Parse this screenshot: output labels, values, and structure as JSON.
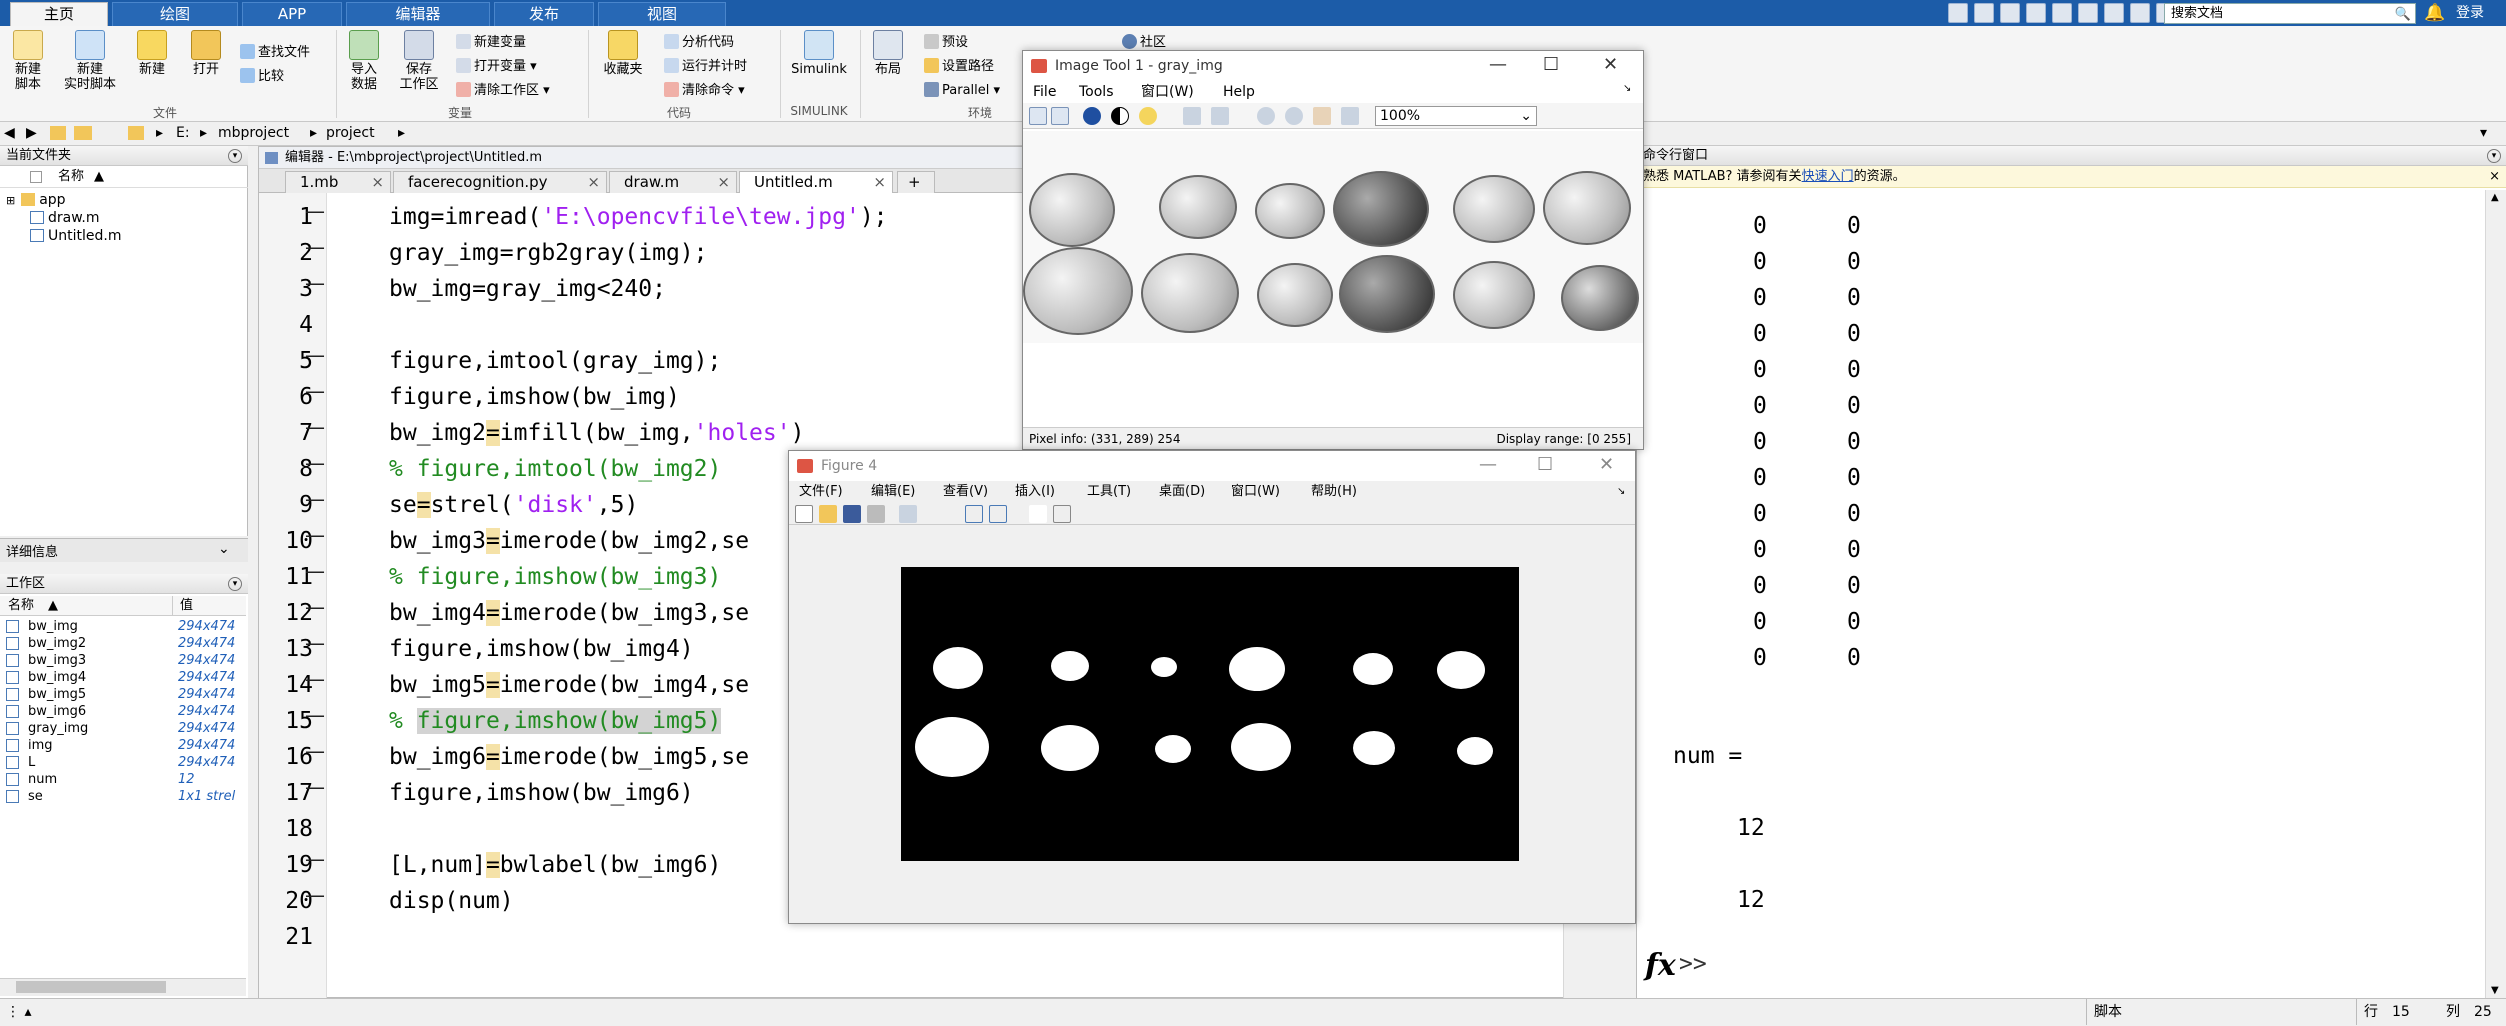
{
  "top_tabs": [
    "主页",
    "绘图",
    "APP",
    "编辑器",
    "发布",
    "视图"
  ],
  "search": {
    "placeholder": "搜索文档"
  },
  "login": "登录",
  "ribbon": {
    "file": {
      "new_script": "新建\n脚本",
      "new_live": "新建\n实时脚本",
      "new": "新建",
      "open": "打开",
      "find_files": "查找文件",
      "compare": "比较",
      "group": "文件"
    },
    "variable": {
      "import": "导入\n数据",
      "save_ws": "保存\n工作区",
      "new_var": "新建变量",
      "open_var": "打开变量",
      "clear_ws": "清除工作区",
      "group": "变量"
    },
    "code": {
      "favorites": "收藏夹",
      "analyze": "分析代码",
      "run_time": "运行并计时",
      "clear_cmd": "清除命令",
      "group": "代码"
    },
    "simulink": {
      "label": "Simulink",
      "group": "SIMULINK"
    },
    "env": {
      "layout": "布局",
      "prefs": "预设",
      "set_path": "设置路径",
      "parallel": "Parallel",
      "group": "环境"
    },
    "community": "社区"
  },
  "address": {
    "drive": "E:",
    "seg1": "mbproject",
    "seg2": "project"
  },
  "current_folder": {
    "title": "当前文件夹",
    "col": "名称",
    "items": [
      "app",
      "draw.m",
      "Untitled.m"
    ]
  },
  "details": {
    "title": "详细信息"
  },
  "workspace": {
    "title": "工作区",
    "col_name": "名称",
    "col_value": "值",
    "rows": [
      {
        "name": "bw_img",
        "value": "294x474"
      },
      {
        "name": "bw_img2",
        "value": "294x474"
      },
      {
        "name": "bw_img3",
        "value": "294x474"
      },
      {
        "name": "bw_img4",
        "value": "294x474"
      },
      {
        "name": "bw_img5",
        "value": "294x474"
      },
      {
        "name": "bw_img6",
        "value": "294x474"
      },
      {
        "name": "gray_img",
        "value": "294x474"
      },
      {
        "name": "img",
        "value": "294x474"
      },
      {
        "name": "L",
        "value": "294x474"
      },
      {
        "name": "num",
        "value": "12"
      },
      {
        "name": "se",
        "value": "1x1 strel"
      }
    ]
  },
  "editor": {
    "title": "编辑器 - E:\\mbproject\\project\\Untitled.m",
    "tabs": [
      "1.mb",
      "facerecognition.py",
      "draw.m",
      "Untitled.m"
    ],
    "lines": [
      "img=imread('E:\\opencvfile\\tew.jpg');",
      "gray_img=rgb2gray(img);",
      "bw_img=gray_img<240;",
      "",
      "figure,imtool(gray_img);",
      "figure,imshow(bw_img)",
      "bw_img2=imfill(bw_img,'holes')",
      "% figure,imtool(bw_img2)",
      "se=strel('disk',5)",
      "bw_img3=imerode(bw_img2,se",
      "% figure,imshow(bw_img3)",
      "bw_img4=imerode(bw_img3,se",
      "figure,imshow(bw_img4)",
      "bw_img5=imerode(bw_img4,se",
      "% figure,imshow(bw_img5)",
      "bw_img6=imerode(bw_img5,se",
      "figure,imshow(bw_img6)",
      "",
      "[L,num]=bwlabel(bw_img6)",
      "disp(num)",
      ""
    ]
  },
  "imtool": {
    "title": "Image Tool 1 - gray_img",
    "menu": [
      "File",
      "Tools",
      "窗口(W)",
      "Help"
    ],
    "zoom": "100%",
    "pixel_info": "Pixel info: (331, 289)  254",
    "display_range": "Display range: [0 255]"
  },
  "fig4": {
    "title": "Figure 4",
    "menu": [
      "文件(F)",
      "编辑(E)",
      "查看(V)",
      "插入(I)",
      "工具(T)",
      "桌面(D)",
      "窗口(W)",
      "帮助(H)"
    ]
  },
  "cmd": {
    "title": "命令行窗口",
    "banner_pre": "熟悉 MATLAB? 请参阅有关",
    "banner_link": "快速入门",
    "banner_post": "的资源。",
    "zero_cell": "0",
    "num_label": "num =",
    "num_val": "12",
    "disp_val": "12",
    "prompt": ">>"
  },
  "status": {
    "mode": "脚本",
    "row_label": "行",
    "row": "15",
    "col_label": "列",
    "col": "25"
  }
}
